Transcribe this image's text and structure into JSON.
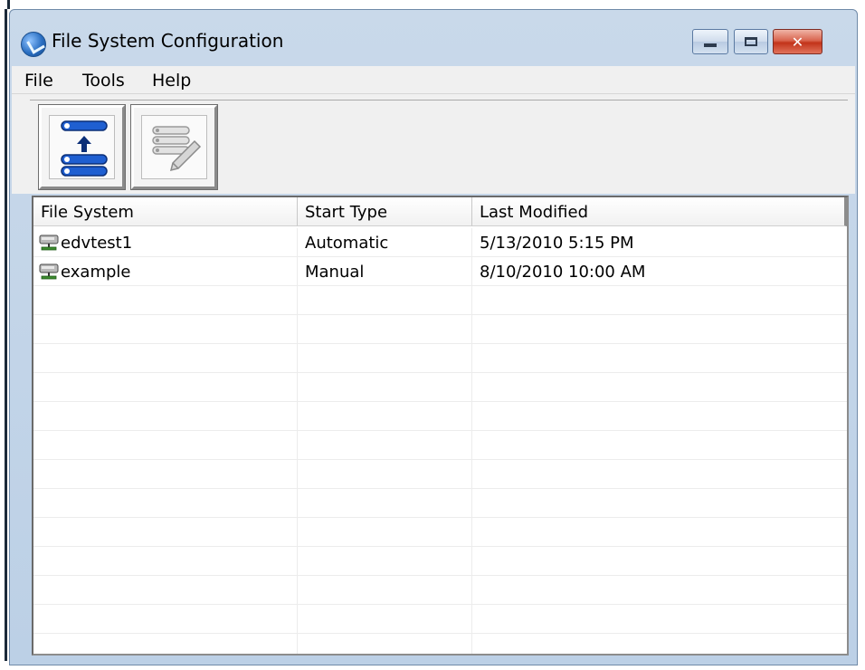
{
  "window": {
    "title": "File System Configuration",
    "controls": {
      "minimize": "minimize",
      "maximize": "maximize",
      "close": "close"
    }
  },
  "menu": {
    "items": [
      "File",
      "Tools",
      "Help"
    ]
  },
  "toolbar": {
    "buttons": [
      {
        "name": "import-file-system-button",
        "icon": "list-upload-icon"
      },
      {
        "name": "edit-file-system-button",
        "icon": "list-edit-icon",
        "disabled": true
      }
    ]
  },
  "table": {
    "columns": [
      "File System",
      "Start Type",
      "Last Modified"
    ],
    "rows": [
      {
        "file_system": "edvtest1",
        "start_type": "Automatic",
        "last_modified": "5/13/2010 5:15 PM",
        "icon": "network-drive-icon"
      },
      {
        "file_system": "example",
        "start_type": "Manual",
        "last_modified": "8/10/2010 10:00 AM",
        "icon": "network-drive-icon"
      }
    ]
  },
  "colors": {
    "window_frame": "#bcd0e6",
    "close_button": "#c2331a",
    "accent_blue": "#1f5fd1"
  }
}
